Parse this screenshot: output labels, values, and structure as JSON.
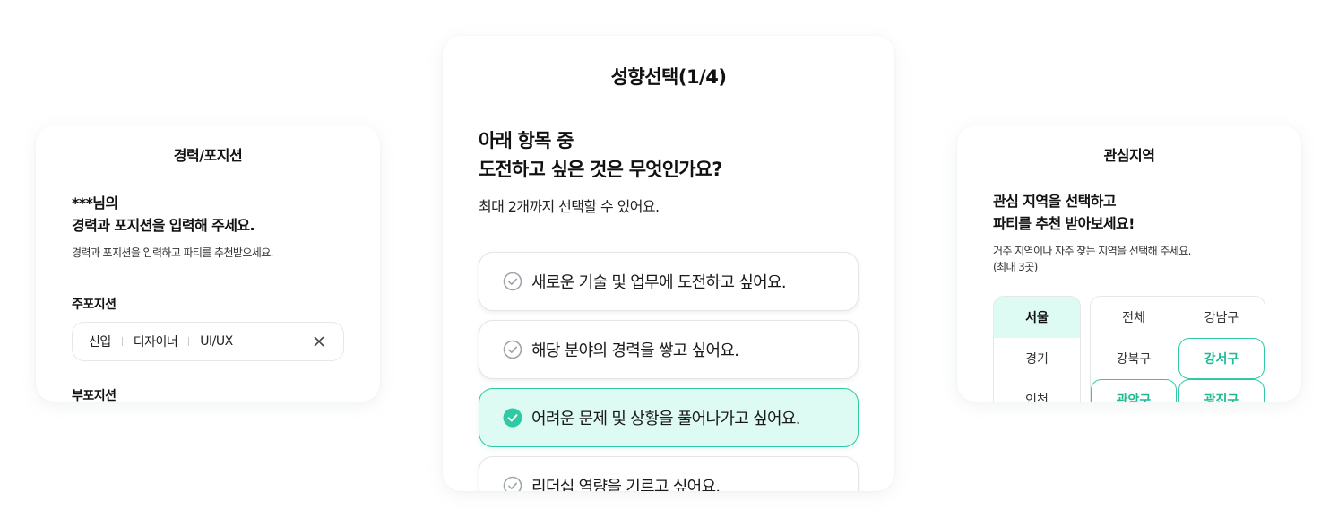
{
  "left_card": {
    "title": "경력/포지션",
    "heading_line1": "***님의",
    "heading_line2": "경력과 포지션을 입력해 주세요.",
    "subtitle": "경력과 포지션을 입력하고 파티를 추천받으세요.",
    "main_position_label": "주포지션",
    "main_position_value": {
      "level": "신입",
      "job": "디자이너",
      "field": "UI/UX"
    },
    "clear_icon": "close-icon",
    "sub_position_label": "부포지션"
  },
  "center_card": {
    "title": "성향선택(1/4)",
    "question_line1": "아래 항목 중",
    "question_line2": "도전하고 싶은 것은 무엇인가요?",
    "hint": "최대 2개까지 선택할 수 있어요.",
    "options": [
      {
        "label": "새로운 기술 및 업무에 도전하고 싶어요.",
        "selected": false
      },
      {
        "label": "해당 분야의 경력을 쌓고 싶어요.",
        "selected": false
      },
      {
        "label": "어려운 문제 및 상황을 풀어나가고 싶어요.",
        "selected": true
      },
      {
        "label": "리더십 역량을 기르고 싶어요.",
        "selected": false
      }
    ]
  },
  "right_card": {
    "title": "관심지역",
    "heading_line1": "관심 지역을 선택하고",
    "heading_line2": "파티를 추천 받아보세요!",
    "subtitle_line1": "거주 지역이나 자주 찾는 지역을 선택해 주세요.",
    "subtitle_line2": "(최대 3곳)",
    "regions": [
      {
        "label": "서울",
        "active": true
      },
      {
        "label": "경기",
        "active": false
      },
      {
        "label": "인천",
        "active": false
      }
    ],
    "districts": [
      {
        "label": "전체",
        "selected": false
      },
      {
        "label": "강남구",
        "selected": false
      },
      {
        "label": "강북구",
        "selected": false
      },
      {
        "label": "강서구",
        "selected": true
      },
      {
        "label": "관악구",
        "selected": true
      },
      {
        "label": "광진구",
        "selected": true
      }
    ]
  },
  "colors": {
    "accent": "#2fc9a3",
    "accent_text": "#1fb993",
    "selected_bg": "#ddfaf3",
    "border": "#e5e7e9"
  }
}
